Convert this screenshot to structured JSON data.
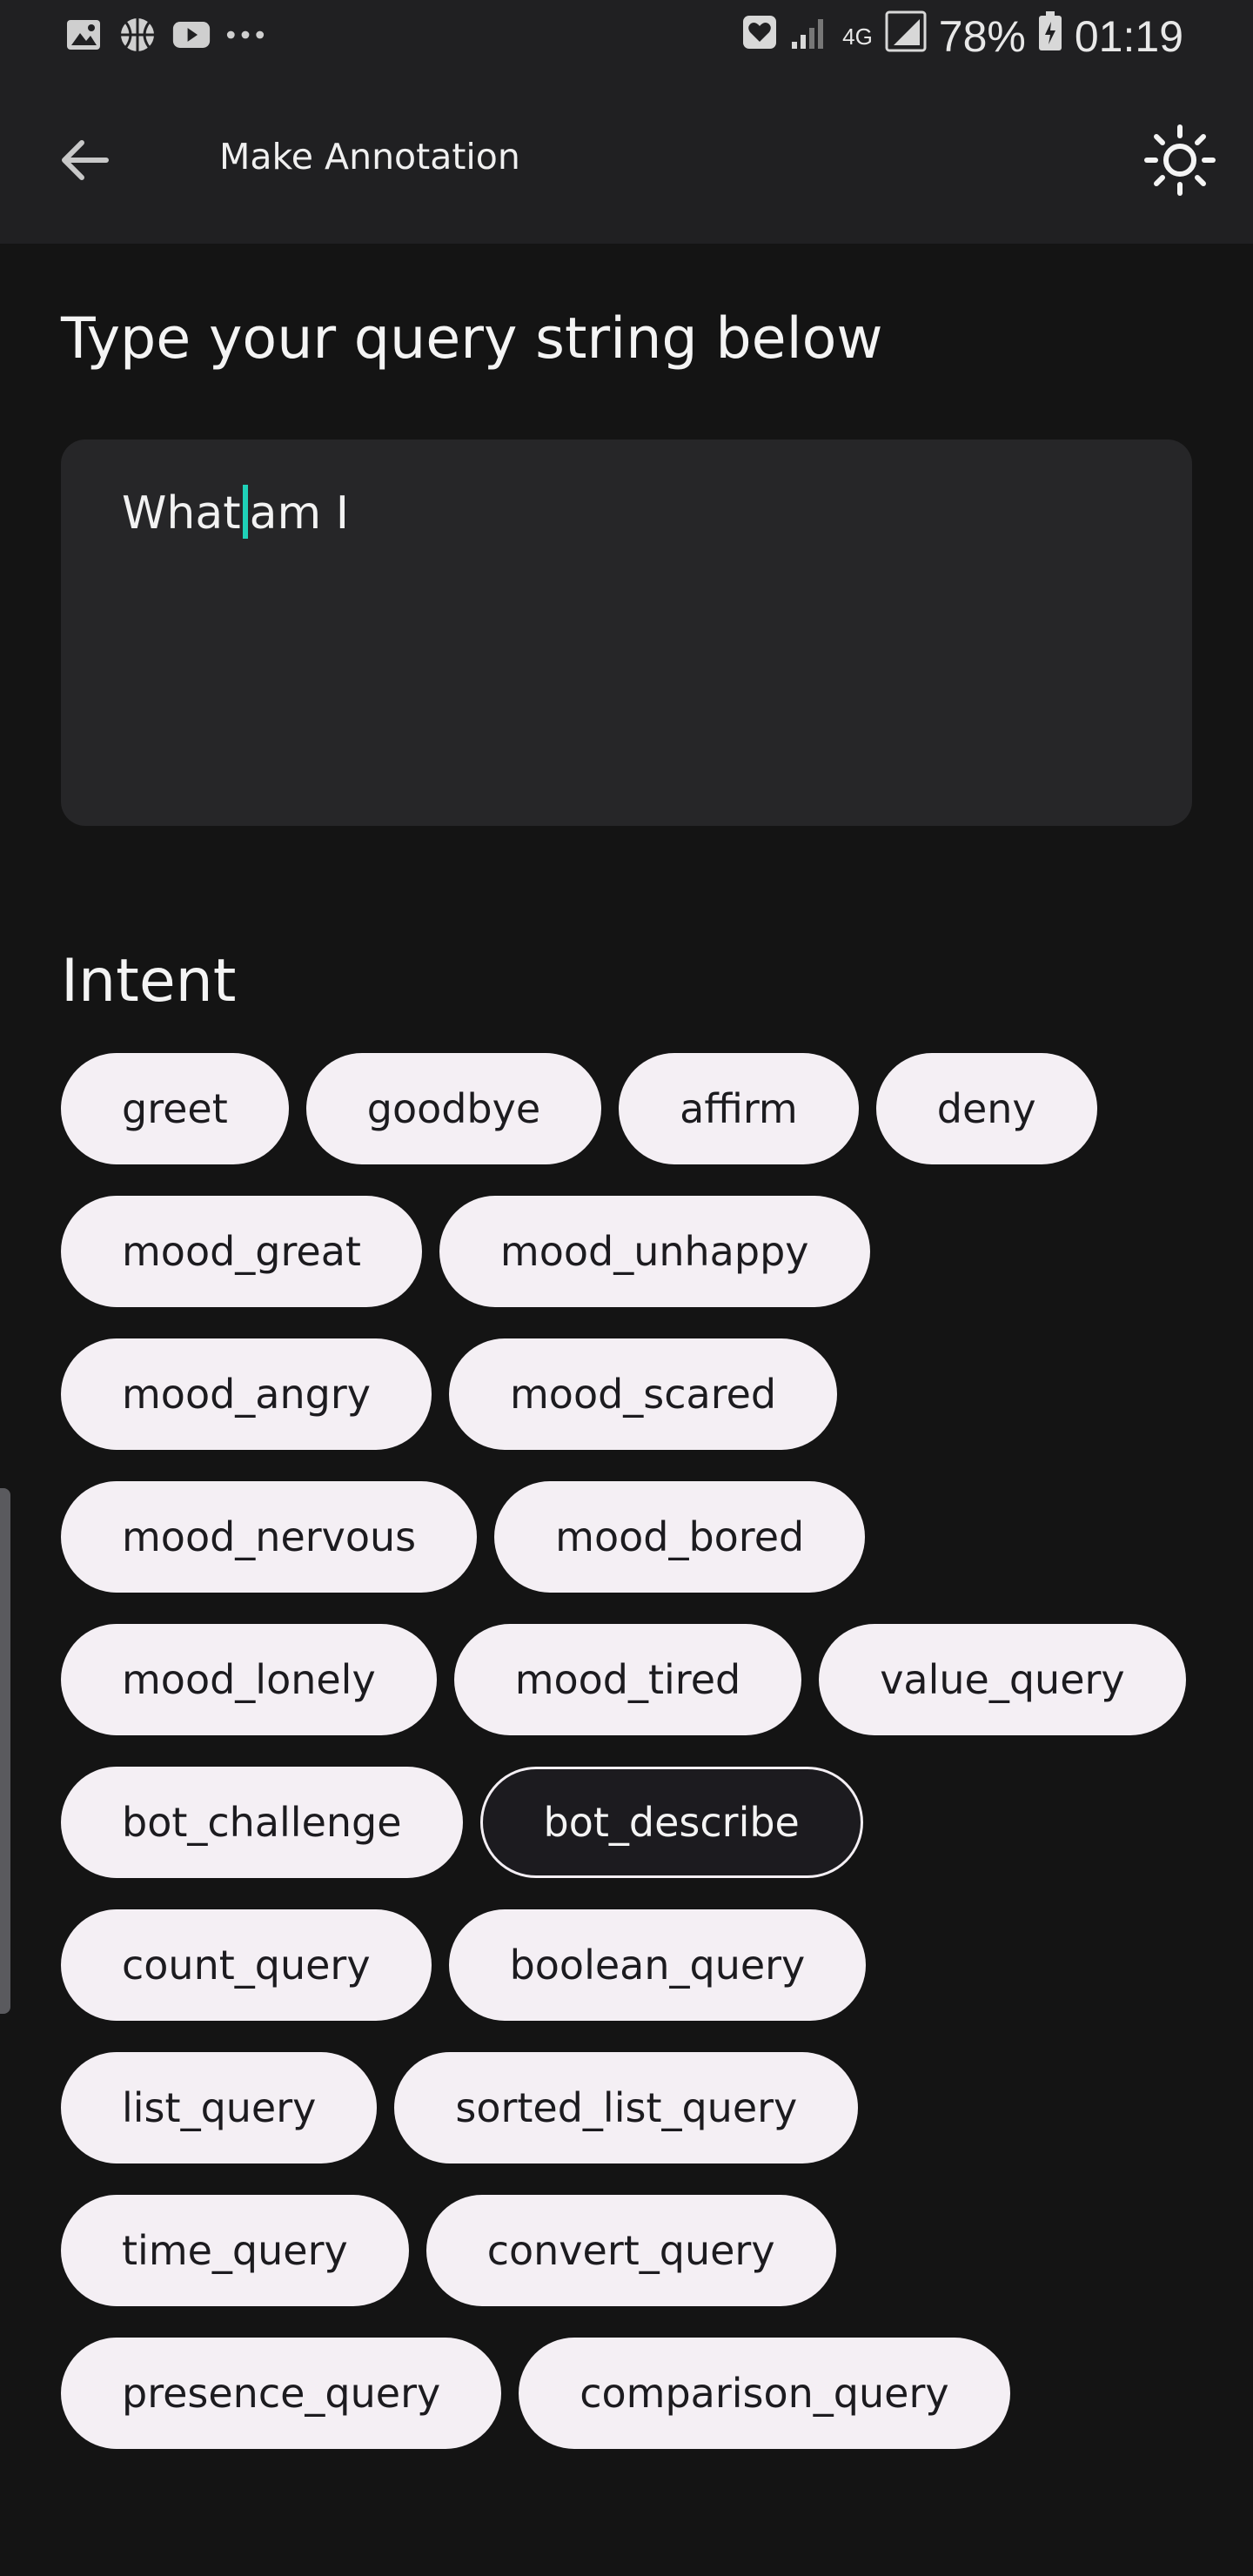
{
  "status_bar": {
    "left_icons": [
      "gallery-icon",
      "basketball-icon",
      "youtube-icon",
      "more-dots-icon"
    ],
    "network": "4G",
    "battery": "78%",
    "time": "01:19"
  },
  "app_bar": {
    "title": "Make Annotation",
    "back_icon": "arrow-back-icon",
    "theme_icon": "sun-icon"
  },
  "query": {
    "prompt": "Type your query string below",
    "text_before_cursor": "What",
    "text_after_cursor": "am I"
  },
  "intent": {
    "heading": "Intent",
    "selected": "bot_describe",
    "rows": [
      [
        "greet",
        "goodbye",
        "affirm",
        "deny"
      ],
      [
        "mood_great",
        "mood_unhappy"
      ],
      [
        "mood_angry",
        "mood_scared"
      ],
      [
        "mood_nervous",
        "mood_bored"
      ],
      [
        "mood_lonely",
        "mood_tired",
        "value_query"
      ],
      [
        "bot_challenge",
        "bot_describe"
      ],
      [
        "count_query",
        "boolean_query"
      ],
      [
        "list_query",
        "sorted_list_query"
      ],
      [
        "time_query",
        "convert_query"
      ],
      [
        "presence_query",
        "comparison_query"
      ]
    ]
  },
  "colors": {
    "background": "#141414",
    "bar": "#202022",
    "input_bg": "#262628",
    "chip_bg": "#f4eff4",
    "chip_text": "#1c1b1f",
    "cursor": "#1fd1b8"
  }
}
